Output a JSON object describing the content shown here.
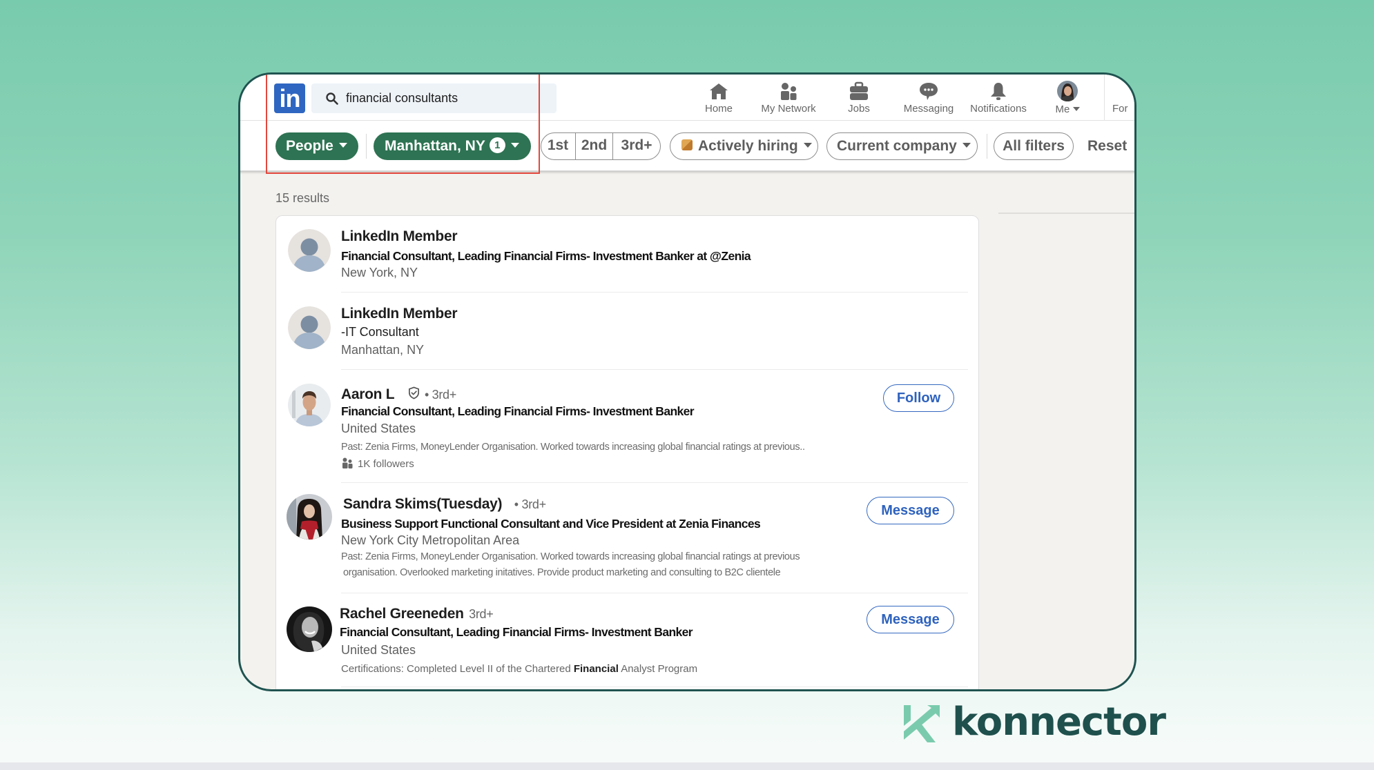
{
  "brand": {
    "name": "konnector",
    "colors": {
      "accent_green": "#2e7353",
      "linkedin_blue": "#2f66c1",
      "highlight_red": "#e3473c",
      "konnector_dark": "#1f504d",
      "konnector_light": "#7acbae"
    }
  },
  "header": {
    "logo_text": "in",
    "search": {
      "value": "financial consultants",
      "icon": "search-icon"
    },
    "nav": [
      {
        "label": "Home",
        "icon": "home-icon"
      },
      {
        "label": "My Network",
        "icon": "network-icon"
      },
      {
        "label": "Jobs",
        "icon": "briefcase-icon"
      },
      {
        "label": "Messaging",
        "icon": "chat-icon"
      },
      {
        "label": "Notifications",
        "icon": "bell-icon"
      },
      {
        "label": "Me",
        "icon": "profile-avatar"
      },
      {
        "label": "For"
      }
    ]
  },
  "filters": {
    "people": "People",
    "location": "Manhattan, NY",
    "location_count": "1",
    "degrees": [
      "1st",
      "2nd",
      "3rd+"
    ],
    "actively_hiring": "Actively hiring",
    "current_company": "Current company",
    "all_filters": "All filters",
    "reset": "Reset"
  },
  "results": {
    "count_label": "15 results",
    "items": [
      {
        "name": "LinkedIn Member",
        "title": "Financial Consultant, Leading Financial Firms- Investment Banker at @Zenia",
        "location": "New York, NY"
      },
      {
        "name": "LinkedIn Member",
        "title": "-IT Consultant",
        "location": "Manhattan, NY"
      },
      {
        "name": "Aaron L",
        "degree": "• 3rd+",
        "verified": true,
        "title": "Financial Consultant, Leading Financial Firms- Investment Banker",
        "location": "United States",
        "past": "Past: Zenia Firms, MoneyLender Organisation. Worked towards increasing global financial ratings at previous..",
        "followers": "1K followers",
        "action": "Follow"
      },
      {
        "name": "Sandra Skims(Tuesday)",
        "degree": "• 3rd+",
        "title": "Business Support Functional  Consultant and Vice President at Zenia Finances",
        "location": "New York City Metropolitan Area",
        "past_line1": "Past: Zenia Firms, MoneyLender Organisation. Worked towards increasing global financial ratings at previous",
        "past_line2": "organisation. Overlooked marketing initatives. Provide product marketing and consulting to B2C clientele",
        "action": "Message"
      },
      {
        "name": "Rachel Greeneden",
        "degree": "3rd+",
        "title": "Financial Consultant, Leading Financial Firms- Investment Banker",
        "location": "United States",
        "cert_prefix": "Certifications: Completed Level II of the Chartered ",
        "cert_bold": "Financial",
        "cert_suffix": " Analyst Program",
        "action": "Message"
      }
    ]
  }
}
